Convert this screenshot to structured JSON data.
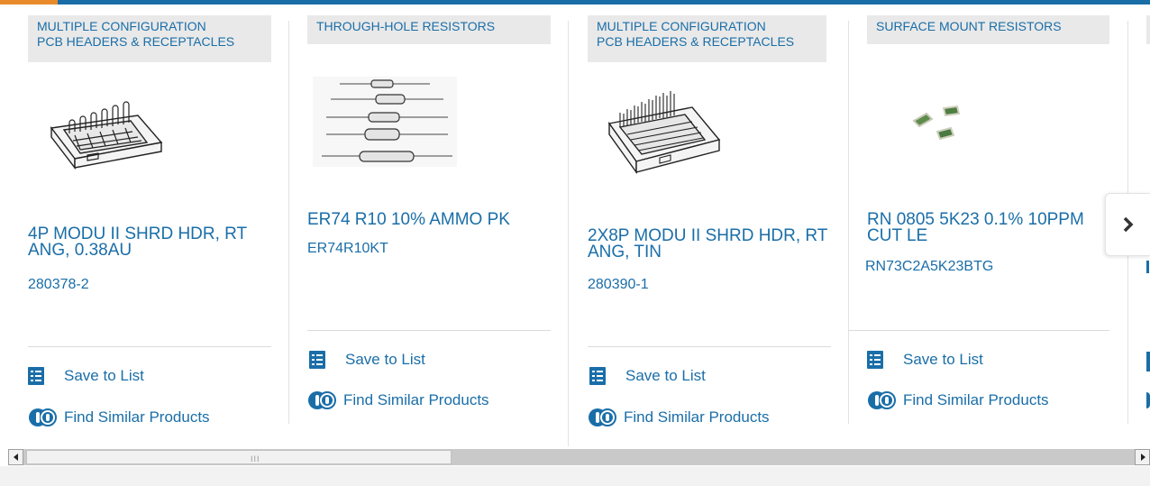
{
  "products": [
    {
      "category_lines": [
        "MULTIPLE CONFIGURATION",
        "PCB HEADERS & RECEPTACLES"
      ],
      "title": "4P MODU II SHRD HDR, RT ANG, 0.38AU",
      "part_number": "280378-2",
      "save_label": "Save to List",
      "similar_label": "Find Similar Products",
      "image_icon": "connector-4p-image"
    },
    {
      "category_lines": [
        "THROUGH-HOLE RESISTORS"
      ],
      "title": "ER74 R10 10% AMMO PK",
      "part_number": "ER74R10KT",
      "save_label": "Save to List",
      "similar_label": "Find Similar Products",
      "image_icon": "axial-resistors-image"
    },
    {
      "category_lines": [
        "MULTIPLE CONFIGURATION",
        "PCB HEADERS & RECEPTACLES"
      ],
      "title": "2X8P MODU II SHRD HDR, RT ANG, TIN",
      "part_number": "280390-1",
      "save_label": "Save to List",
      "similar_label": "Find Similar Products",
      "image_icon": "connector-2x8p-image"
    },
    {
      "category_lines": [
        "SURFACE MOUNT RESISTORS"
      ],
      "title": "RN 0805 5K23 0.1% 10PPM CUT LE",
      "part_number": "RN73C2A5K23BTG",
      "save_label": "Save to List",
      "similar_label": "Find Similar Products",
      "image_icon": "smd-resistors-image"
    }
  ],
  "next_button_icon": "chevron-right-icon",
  "colors": {
    "link": "#1a6ea8",
    "tag_bg": "#e9e9e9",
    "accent": "#e98a2a"
  }
}
